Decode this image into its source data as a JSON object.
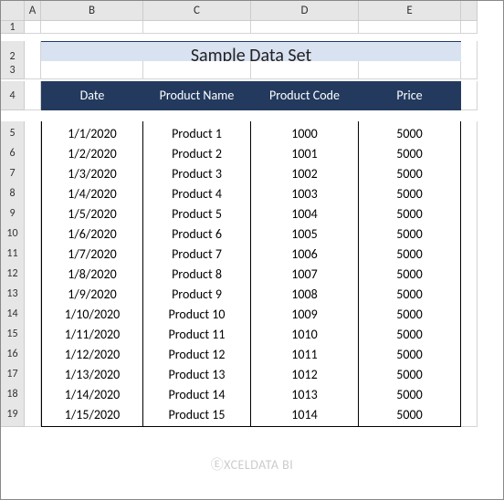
{
  "columns": [
    "A",
    "B",
    "C",
    "D",
    "E"
  ],
  "row_numbers": [
    1,
    2,
    3,
    4,
    5,
    6,
    7,
    8,
    9,
    10,
    11,
    12,
    13,
    14,
    15,
    16,
    17,
    18,
    19
  ],
  "title": "Sample Data Set",
  "headers": {
    "date": "Date",
    "name": "Product Name",
    "code": "Product Code",
    "price": "Price"
  },
  "chart_data": {
    "type": "table",
    "columns": [
      "Date",
      "Product Name",
      "Product Code",
      "Price"
    ],
    "rows": [
      {
        "date": "1/1/2020",
        "name": "Product 1",
        "code": "1000",
        "price": "5000"
      },
      {
        "date": "1/2/2020",
        "name": "Product 2",
        "code": "1001",
        "price": "5000"
      },
      {
        "date": "1/3/2020",
        "name": "Product 3",
        "code": "1002",
        "price": "5000"
      },
      {
        "date": "1/4/2020",
        "name": "Product 4",
        "code": "1003",
        "price": "5000"
      },
      {
        "date": "1/5/2020",
        "name": "Product 5",
        "code": "1004",
        "price": "5000"
      },
      {
        "date": "1/6/2020",
        "name": "Product 6",
        "code": "1005",
        "price": "5000"
      },
      {
        "date": "1/7/2020",
        "name": "Product 7",
        "code": "1006",
        "price": "5000"
      },
      {
        "date": "1/8/2020",
        "name": "Product 8",
        "code": "1007",
        "price": "5000"
      },
      {
        "date": "1/9/2020",
        "name": "Product 9",
        "code": "1008",
        "price": "5000"
      },
      {
        "date": "1/10/2020",
        "name": "Product 10",
        "code": "1009",
        "price": "5000"
      },
      {
        "date": "1/11/2020",
        "name": "Product 11",
        "code": "1010",
        "price": "5000"
      },
      {
        "date": "1/12/2020",
        "name": "Product 12",
        "code": "1011",
        "price": "5000"
      },
      {
        "date": "1/13/2020",
        "name": "Product 13",
        "code": "1012",
        "price": "5000"
      },
      {
        "date": "1/14/2020",
        "name": "Product 14",
        "code": "1013",
        "price": "5000"
      },
      {
        "date": "1/15/2020",
        "name": "Product 15",
        "code": "1014",
        "price": "5000"
      }
    ]
  },
  "watermark": "ⒺXCELDATA BI"
}
